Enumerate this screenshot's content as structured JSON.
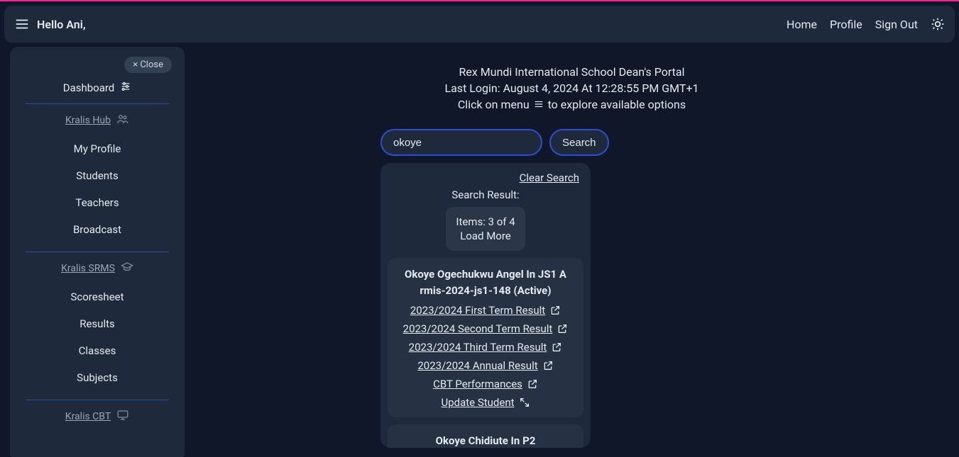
{
  "topbar": {
    "greeting": "Hello Ani,",
    "nav": {
      "home": "Home",
      "profile": "Profile",
      "signout": "Sign Out"
    }
  },
  "sidebar": {
    "close": "× Close",
    "dashboard": "Dashboard",
    "sections": [
      {
        "title": "Kralis Hub",
        "items": [
          "My Profile",
          "Students",
          "Teachers",
          "Broadcast"
        ]
      },
      {
        "title": "Kralis SRMS",
        "items": [
          "Scoresheet",
          "Results",
          "Classes",
          "Subjects"
        ]
      },
      {
        "title": "Kralis CBT",
        "items": []
      }
    ]
  },
  "main": {
    "line1": "Rex Mundi International School Dean's Portal",
    "line2": "Last Login: August 4, 2024 At 12:28:55 PM GMT+1",
    "line3_pre": "Click on menu ",
    "line3_post": " to explore available options",
    "search_value": "okoye",
    "search_button": "Search",
    "clear_search": "Clear Search",
    "sr_title": "Search Result:",
    "items_line": "Items: 3 of 4",
    "load_more": "Load More",
    "results": [
      {
        "title_l1": "Okoye Ogechukwu Angel In JS1 A",
        "title_l2": "rmis-2024-js1-148 (Active)",
        "links": [
          {
            "label": "2023/2024 First Term Result",
            "icon": "external"
          },
          {
            "label": "2023/2024 Second Term Result",
            "icon": "external"
          },
          {
            "label": "2023/2024 Third Term Result",
            "icon": "external"
          },
          {
            "label": "2023/2024 Annual Result",
            "icon": "external"
          },
          {
            "label": "CBT Performances",
            "icon": "external"
          },
          {
            "label": "Update Student",
            "icon": "expand"
          }
        ]
      },
      {
        "title_l1": "Okoye Chidiute In P2",
        "title_l2": "",
        "links": []
      }
    ]
  }
}
